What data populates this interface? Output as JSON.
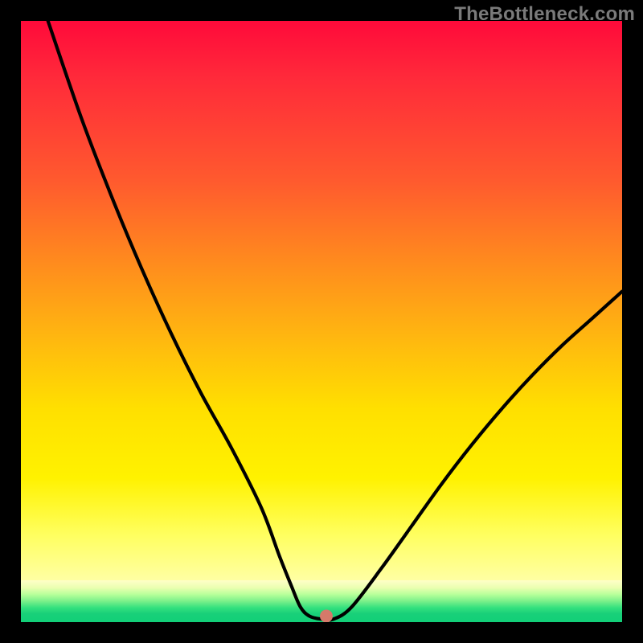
{
  "watermark": "TheBottleneck.com",
  "chart_data": {
    "type": "line",
    "title": "",
    "xlabel": "",
    "ylabel": "",
    "xlim": [
      0,
      100
    ],
    "ylim": [
      0,
      100
    ],
    "grid": false,
    "legend": false,
    "background_gradient_top_to_bottom": [
      "#ff0a3a",
      "#ff8a1e",
      "#ffe000",
      "#ffffb5",
      "#12cf78"
    ],
    "series": [
      {
        "name": "bottleneck-curve",
        "color": "#000000",
        "x": [
          4.5,
          10,
          15,
          20,
          25,
          30,
          35,
          40,
          43,
          45,
          46.5,
          48,
          50,
          52,
          55,
          60,
          65,
          70,
          75,
          80,
          85,
          90,
          95,
          100
        ],
        "y": [
          100,
          84,
          71,
          59,
          48,
          38,
          29,
          19,
          11,
          6,
          2.5,
          1,
          0.5,
          0.5,
          2.5,
          9,
          16,
          23,
          29.5,
          35.5,
          41,
          46,
          50.5,
          55
        ]
      }
    ],
    "marker": {
      "name": "vertex-marker",
      "x": 50.8,
      "y": 1,
      "color": "#d6796a",
      "r": 8
    }
  }
}
